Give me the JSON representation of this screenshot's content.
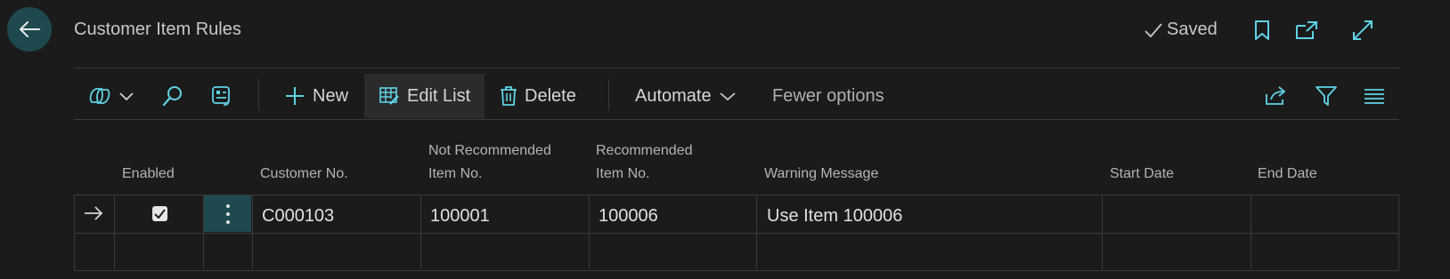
{
  "header": {
    "title": "Customer Item Rules",
    "saved_label": "Saved",
    "icons": [
      "back-arrow-icon",
      "checkmark-icon",
      "bookmark-icon",
      "open-new-window-icon",
      "expand-icon"
    ]
  },
  "toolbar": {
    "new_label": "New",
    "edit_list_label": "Edit List",
    "delete_label": "Delete",
    "automate_label": "Automate",
    "fewer_options_label": "Fewer options",
    "icons": [
      "copilot-icon",
      "chevron-down-icon",
      "search-icon",
      "refresh-view-icon",
      "plus-icon",
      "edit-grid-icon",
      "trash-icon",
      "share-icon",
      "filter-icon",
      "list-view-icon"
    ]
  },
  "table": {
    "columns": {
      "enabled": "Enabled",
      "customer_no": "Customer No.",
      "not_recommended_line1": "Not Recommended",
      "not_recommended_line2": "Item No.",
      "recommended_line1": "Recommended",
      "recommended_line2": "Item No.",
      "warning_message": "Warning Message",
      "start_date": "Start Date",
      "end_date": "End Date"
    },
    "rows": [
      {
        "enabled": true,
        "customer_no": "C000103",
        "not_recommended_item_no": "100001",
        "recommended_item_no": "100006",
        "warning_message": "Use Item 100006",
        "start_date": "",
        "end_date": ""
      }
    ]
  },
  "colors": {
    "background": "#1b1b1b",
    "accent": "#5fd3e6",
    "teal_button": "#1e4a4f"
  }
}
